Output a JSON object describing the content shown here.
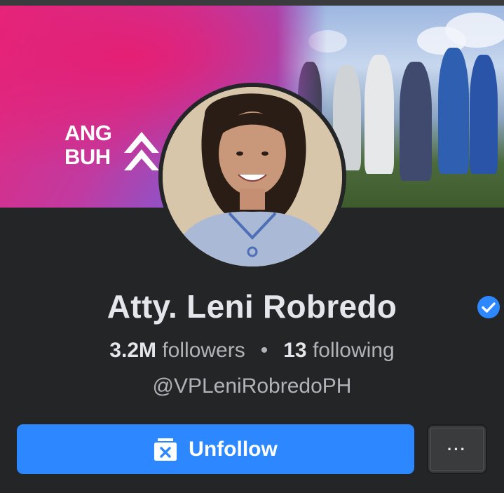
{
  "profile": {
    "name": "Atty. Leni Robredo",
    "followers_count": "3.2M",
    "followers_label": "followers",
    "separator": "•",
    "following_count": "13",
    "following_label": "following",
    "handle": "@VPLeniRobredoPH",
    "verified": true
  },
  "cover": {
    "brand_line1": "ANG",
    "brand_line2": "BUH"
  },
  "actions": {
    "unfollow_label": "Unfollow",
    "more_label": "···"
  },
  "colors": {
    "background": "#242526",
    "primary_button": "#2d88ff",
    "verified_badge": "#2d88ff",
    "text_primary": "#e4e6eb",
    "text_secondary": "#b0b3b8"
  },
  "icons": {
    "verified": "verified-check-icon",
    "unfollow": "unfollow-icon",
    "more": "more-options-icon"
  }
}
